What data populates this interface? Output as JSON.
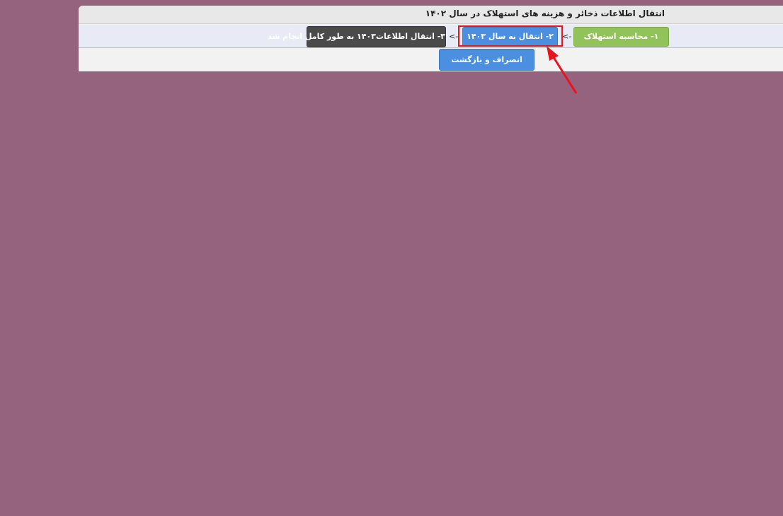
{
  "window": {
    "title": "انتقال اطلاعات ذخائر و هزینه های استهلاک در سال ۱۴۰۲"
  },
  "steps": [
    {
      "label": "۱- محاسبه استهلاک",
      "color": "#92c25a"
    },
    {
      "label": "۲- انتقال به سال ۱۴۰۳",
      "color": "#4a8fe0"
    },
    {
      "label": "۳- انتقال اطلاعات۱۴۰۳ به طور کامل انجام شد",
      "color": "#4a4a4a"
    }
  ],
  "separators": [
    "<-",
    "<-"
  ],
  "actions": {
    "cancel_label": "انصراف و بازگشت"
  },
  "colors": {
    "background": "#96637f",
    "highlight": "#e8141b"
  }
}
